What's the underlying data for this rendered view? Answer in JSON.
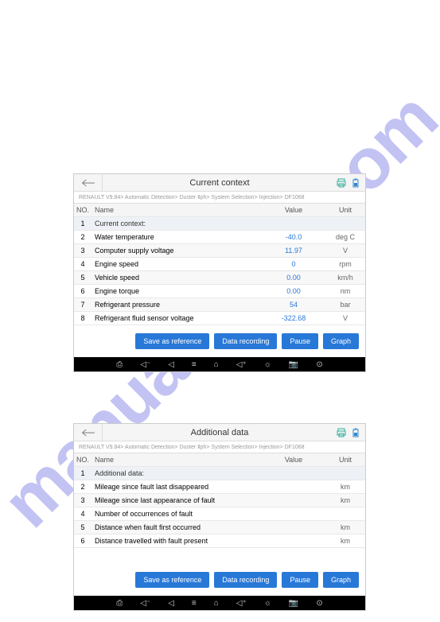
{
  "watermark": "manualshive.com",
  "screens": [
    {
      "title": "Current context",
      "breadcrumb": "RENAULT V9.84> Automatic Detection> Duster Ⅱph> System Selection> Injection> DF1068",
      "columns": {
        "no": "NO.",
        "name": "Name",
        "value": "Value",
        "unit": "Unit"
      },
      "rows": [
        {
          "no": "1",
          "name": "Current context:",
          "value": "",
          "unit": "",
          "section": true
        },
        {
          "no": "2",
          "name": "Water temperature",
          "value": "-40.0",
          "unit": "deg C"
        },
        {
          "no": "3",
          "name": "Computer supply voltage",
          "value": "11.97",
          "unit": "V"
        },
        {
          "no": "4",
          "name": "Engine speed",
          "value": "0",
          "unit": "rpm"
        },
        {
          "no": "5",
          "name": "Vehicle speed",
          "value": "0.00",
          "unit": "km/h"
        },
        {
          "no": "6",
          "name": "Engine torque",
          "value": "0.00",
          "unit": "nm"
        },
        {
          "no": "7",
          "name": "Refrigerant pressure",
          "value": "54",
          "unit": "bar"
        },
        {
          "no": "8",
          "name": "Refrigerant fluid sensor voltage",
          "value": "-322.68",
          "unit": "V"
        }
      ],
      "buttons": {
        "save": "Save as reference",
        "record": "Data recording",
        "pause": "Pause",
        "graph": "Graph"
      }
    },
    {
      "title": "Additional data",
      "breadcrumb": "RENAULT V9.84> Automatic Detection> Duster Ⅱph> System Selection> Injection> DF1068",
      "columns": {
        "no": "NO.",
        "name": "Name",
        "value": "Value",
        "unit": "Unit"
      },
      "rows": [
        {
          "no": "1",
          "name": "Additional data:",
          "value": "",
          "unit": "",
          "section": true
        },
        {
          "no": "2",
          "name": "Mileage since fault last disappeared",
          "value": "",
          "unit": "km"
        },
        {
          "no": "3",
          "name": "Mileage since last appearance of fault",
          "value": "",
          "unit": "km"
        },
        {
          "no": "4",
          "name": "Number of occurrences of fault",
          "value": "",
          "unit": ""
        },
        {
          "no": "5",
          "name": "Distance when fault first occurred",
          "value": "",
          "unit": "km"
        },
        {
          "no": "6",
          "name": "Distance travelled with fault present",
          "value": "",
          "unit": "km"
        }
      ],
      "buttons": {
        "save": "Save as reference",
        "record": "Data recording",
        "pause": "Pause",
        "graph": "Graph"
      }
    }
  ]
}
